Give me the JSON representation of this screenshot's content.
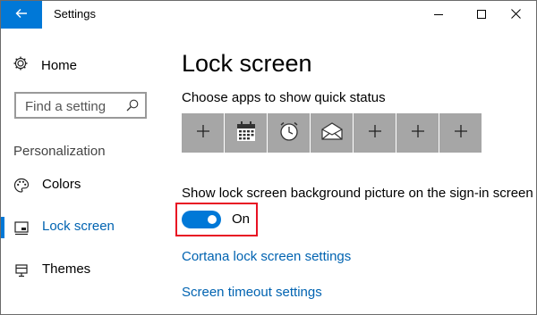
{
  "window": {
    "title": "Settings",
    "accent": "#0078d7",
    "icons": {
      "back": "back-arrow-icon",
      "minimize": "minimize-icon",
      "maximize": "maximize-icon",
      "close": "close-icon"
    }
  },
  "sidebar": {
    "home_label": "Home",
    "search_placeholder": "Find a setting",
    "section_title": "Personalization",
    "items": [
      {
        "label": "Colors",
        "icon": "palette-icon",
        "active": false
      },
      {
        "label": "Lock screen",
        "icon": "lock-screen-icon",
        "active": true
      },
      {
        "label": "Themes",
        "icon": "themes-icon",
        "active": false
      }
    ]
  },
  "main": {
    "title": "Lock screen",
    "quick_status_label": "Choose apps to show quick status",
    "quick_status_tiles": [
      "plus-icon",
      "calendar-icon",
      "alarm-icon",
      "mail-icon",
      "plus-icon",
      "plus-icon",
      "plus-icon"
    ],
    "background_toggle_label": "Show lock screen background picture on the sign-in screen",
    "background_toggle_state": "On",
    "background_toggle_on": true,
    "links": {
      "cortana": "Cortana lock screen settings",
      "timeout": "Screen timeout settings"
    }
  }
}
